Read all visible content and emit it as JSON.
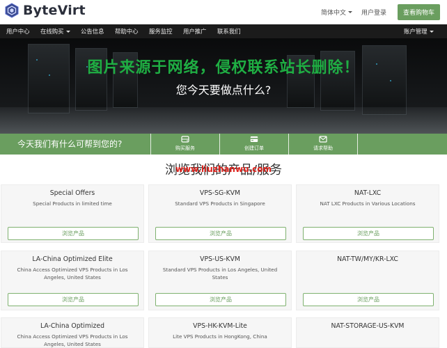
{
  "brand": {
    "name": "ByteVirt",
    "accent": "#6a9e5f"
  },
  "topbar": {
    "language": "简体中文",
    "login": "用户登录",
    "cart": "查看购物车"
  },
  "nav": {
    "items": [
      "用户中心",
      "在线购买",
      "公告信息",
      "帮助中心",
      "服务监控",
      "用户推广",
      "联系我们"
    ],
    "account": "账户管理"
  },
  "hero": {
    "watermark": "图片来源于网络，侵权联系站长删除！",
    "title": "您今天要做点什么?"
  },
  "help": {
    "title": "今天我们有什么可帮到您的?",
    "buttons": [
      {
        "label": "购买服务",
        "icon": "server-icon"
      },
      {
        "label": "创建订单",
        "icon": "credit-card-icon"
      },
      {
        "label": "请求帮助",
        "icon": "envelope-icon"
      }
    ]
  },
  "section": {
    "title": "浏览我们的产品/服务",
    "watermark": "www.liuzhanwu.com"
  },
  "products": [
    {
      "title": "Special Offers",
      "desc": "Special Products in limited time",
      "button": "浏览产品"
    },
    {
      "title": "VPS-SG-KVM",
      "desc": "Standard VPS Products in Singapore",
      "button": "浏览产品"
    },
    {
      "title": "NAT-LXC",
      "desc": "NAT LXC Products in Various Locations",
      "button": "浏览产品"
    },
    {
      "title": "LA-China Optimized Elite",
      "desc": "China Access Optimized VPS Products in Los Angeles, United States",
      "button": "浏览产品"
    },
    {
      "title": "VPS-US-KVM",
      "desc": "Standard VPS Products in Los Angeles, United States",
      "button": "浏览产品"
    },
    {
      "title": "NAT-TW/MY/KR-LXC",
      "desc": "",
      "button": "浏览产品"
    },
    {
      "title": "LA-China Optimized",
      "desc": "China Access Optimized VPS Products in Los Angeles, United States",
      "button": ""
    },
    {
      "title": "VPS-HK-KVM-Lite",
      "desc": "Lite VPS Products in HongKong, China",
      "button": ""
    },
    {
      "title": "NAT-STORAGE-US-KVM",
      "desc": "",
      "button": ""
    }
  ]
}
